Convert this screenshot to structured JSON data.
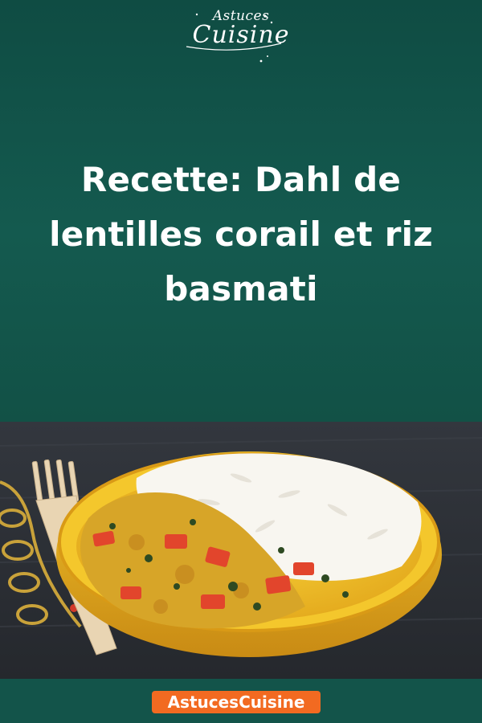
{
  "logo": {
    "line1": "Astuces",
    "line2": "Cuisine"
  },
  "title": {
    "line1": "Recette: Dahl de",
    "line2": "lentilles corail et riz",
    "line3": "basmati"
  },
  "photo": {
    "icon": "dish-photo"
  },
  "footer": {
    "brand": "AstucesCuisine"
  },
  "colors": {
    "background": "#13544a",
    "badge": "#f26a21",
    "text": "#ffffff"
  }
}
